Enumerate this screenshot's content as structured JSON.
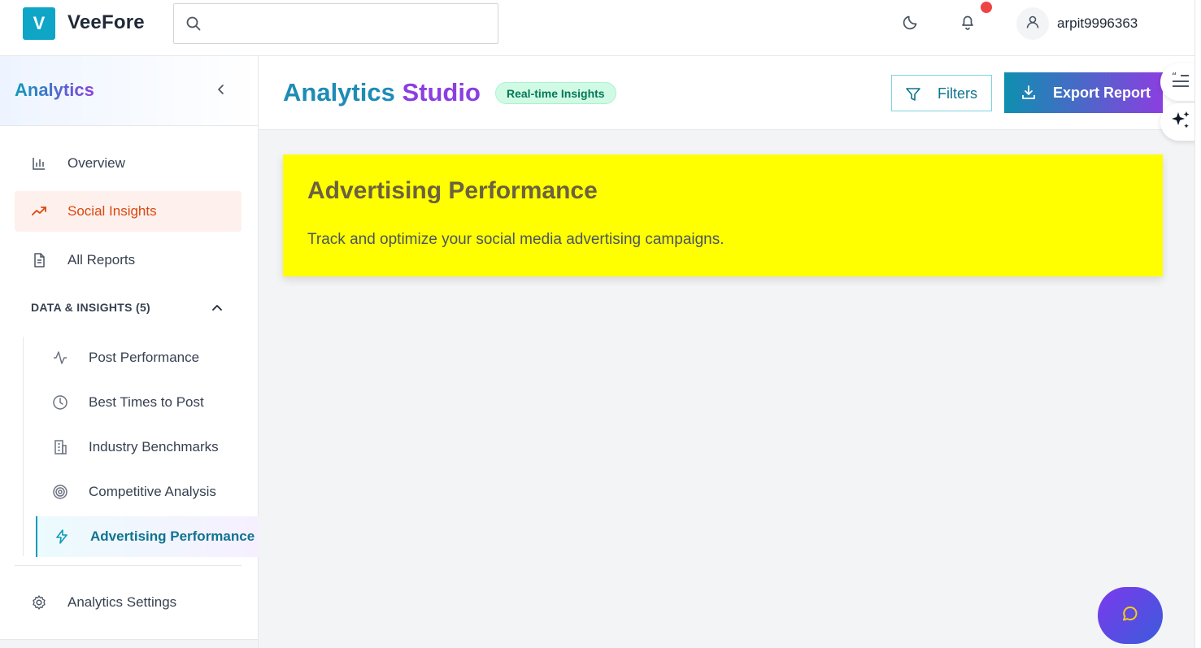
{
  "app": {
    "logo_letter": "V",
    "name": "VeeFore"
  },
  "search": {
    "placeholder": ""
  },
  "user": {
    "name": "arpit9996363"
  },
  "sidebar": {
    "title": "Analytics",
    "items": [
      {
        "label": "Overview",
        "icon": "bar-chart-icon"
      },
      {
        "label": "Social Insights",
        "icon": "trending-up-icon",
        "active": true
      },
      {
        "label": "All Reports",
        "icon": "document-icon"
      }
    ],
    "section": {
      "label": "DATA & INSIGHTS (5)"
    },
    "sub_items": [
      {
        "label": "Post Performance",
        "icon": "activity-icon"
      },
      {
        "label": "Best Times to Post",
        "icon": "clock-icon"
      },
      {
        "label": "Industry Benchmarks",
        "icon": "building-icon"
      },
      {
        "label": "Competitive Analysis",
        "icon": "target-icon"
      },
      {
        "label": "Advertising Performance",
        "icon": "lightning-icon",
        "active": true
      }
    ],
    "settings": {
      "label": "Analytics Settings",
      "icon": "gear-icon"
    }
  },
  "header": {
    "title_part1": "Analytics",
    "title_part2": "Studio",
    "badge": "Real-time Insights",
    "filters_label": "Filters",
    "export_label": "Export Report"
  },
  "hero": {
    "title": "Advertising Performance",
    "subtitle": "Track and optimize your social media advertising campaigns."
  },
  "colors": {
    "accent": "#0e9bb8",
    "purple": "#8b3fe0",
    "active_orange": "#d9480f",
    "hero_bg": "#ffff00",
    "notification": "#ef4444"
  }
}
